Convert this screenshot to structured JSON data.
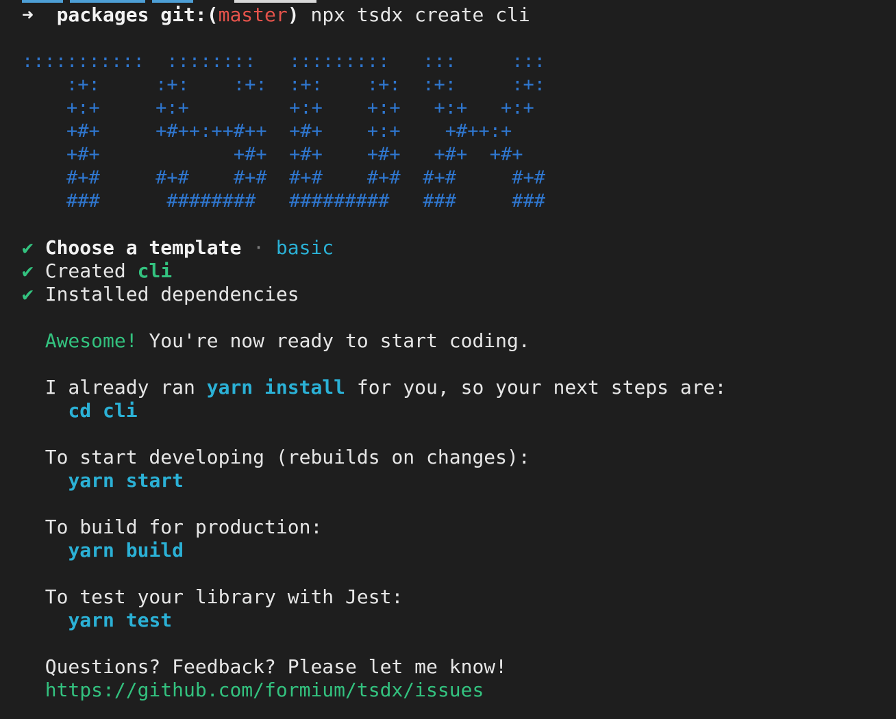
{
  "prompt": {
    "arrow": "➜",
    "dir": "packages",
    "git_label": "git:(",
    "branch": "master",
    "git_close": ")",
    "command": "npx tsdx create cli"
  },
  "logo_lines": [
    ":::::::::::  ::::::::   :::::::::   :::     :::",
    "    :+:     :+:    :+:  :+:    :+:  :+:     :+:",
    "    +:+     +:+         +:+    +:+   +:+   +:+",
    "    +#+     +#++:++#++  +#+    +:+    +#++:+",
    "    +#+            +#+  +#+    +#+   +#+  +#+",
    "    #+#     #+#    #+#  #+#    #+#  #+#     #+#",
    "    ###      ########   #########   ###     ###"
  ],
  "steps": {
    "check": "✔",
    "choose_label": "Choose a template",
    "separator": "·",
    "template": "basic",
    "created_label": "Created",
    "created_name": "cli",
    "installed_label": "Installed dependencies"
  },
  "message": {
    "awesome": "Awesome!",
    "ready": "You're now ready to start coding.",
    "already_pre": "I already ran",
    "already_cmd": "yarn install",
    "already_post": "for you, so your next steps are:",
    "cd_cmd": "cd cli",
    "dev_text": "To start developing (rebuilds on changes):",
    "dev_cmd": "yarn start",
    "build_text": "To build for production:",
    "build_cmd": "yarn build",
    "test_text": "To test your library with Jest:",
    "test_cmd": "yarn test",
    "questions": "Questions? Feedback? Please let me know!",
    "issues_url": "https://github.com/formium/tsdx/issues"
  },
  "colors": {
    "background": "#1e1e1e",
    "green": "#33c27f",
    "cyan": "#2bb1d6",
    "logo_blue": "#2f77d0",
    "branch_red": "#e5534b"
  }
}
